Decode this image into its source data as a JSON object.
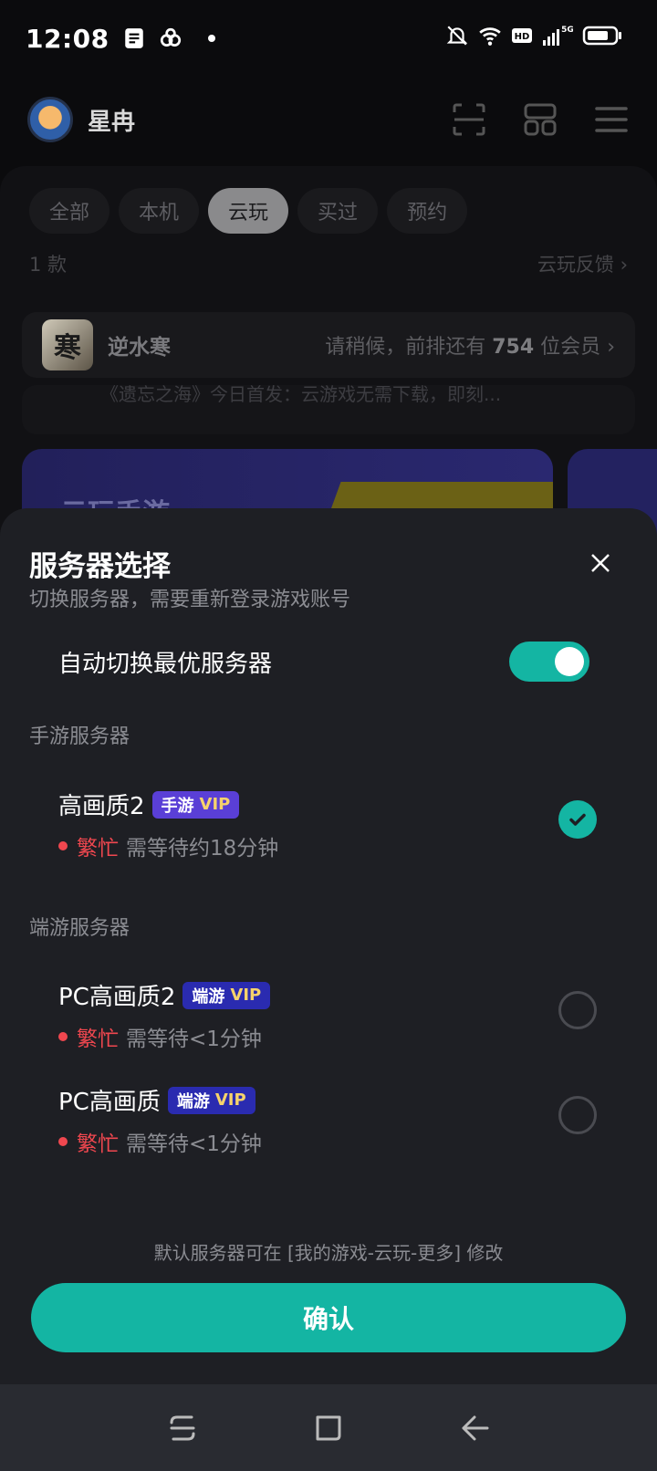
{
  "status_bar": {
    "time": "12:08",
    "icons": [
      "notes-icon",
      "cloud-game-icon",
      "dot-icon",
      "bell-off-icon",
      "wifi-icon",
      "hd-icon",
      "signal-5g-icon",
      "battery-icon"
    ]
  },
  "header": {
    "username": "星冉"
  },
  "tabs": [
    {
      "label": "全部",
      "active": false
    },
    {
      "label": "本机",
      "active": false
    },
    {
      "label": "云玩",
      "active": true
    },
    {
      "label": "买过",
      "active": false
    },
    {
      "label": "预约",
      "active": false
    }
  ],
  "list_meta": {
    "count": "1 款",
    "feedback": "云玩反馈"
  },
  "game": {
    "thumb_char": "寒",
    "name": "逆水寒",
    "queue_prefix": "请稍候，前排还有",
    "queue_number": "754",
    "queue_suffix": "位会员"
  },
  "notice": {
    "text": "《遗忘之海》今日首发：云游戏无需下载，即刻..."
  },
  "banner": {
    "text": "云玩手游"
  },
  "sheet": {
    "title": "服务器选择",
    "subtitle": "切换服务器，需要重新登录游戏账号",
    "auto_switch_label": "自动切换最优服务器",
    "auto_switch_on": true,
    "sections": [
      {
        "label": "手游服务器",
        "servers": [
          {
            "name": "高画质2",
            "badge_type": "手游",
            "badge_vip": "VIP",
            "status": "繁忙",
            "wait": "需等待约18分钟",
            "selected": true
          }
        ]
      },
      {
        "label": "端游服务器",
        "servers": [
          {
            "name": "PC高画质2",
            "badge_type": "端游",
            "badge_vip": "VIP",
            "status": "繁忙",
            "wait": "需等待<1分钟",
            "selected": false
          },
          {
            "name": "PC高画质",
            "badge_type": "端游",
            "badge_vip": "VIP",
            "status": "繁忙",
            "wait": "需等待<1分钟",
            "selected": false
          }
        ]
      }
    ],
    "footer_note": "默认服务器可在 [我的游戏-云玩-更多] 修改",
    "confirm_label": "确认"
  },
  "colors": {
    "accent": "#14b5a3",
    "busy": "#f0474f",
    "vip_text": "#f6d36b",
    "mobile_badge": "#5a3fd6",
    "pc_badge": "#2a2bb0"
  }
}
